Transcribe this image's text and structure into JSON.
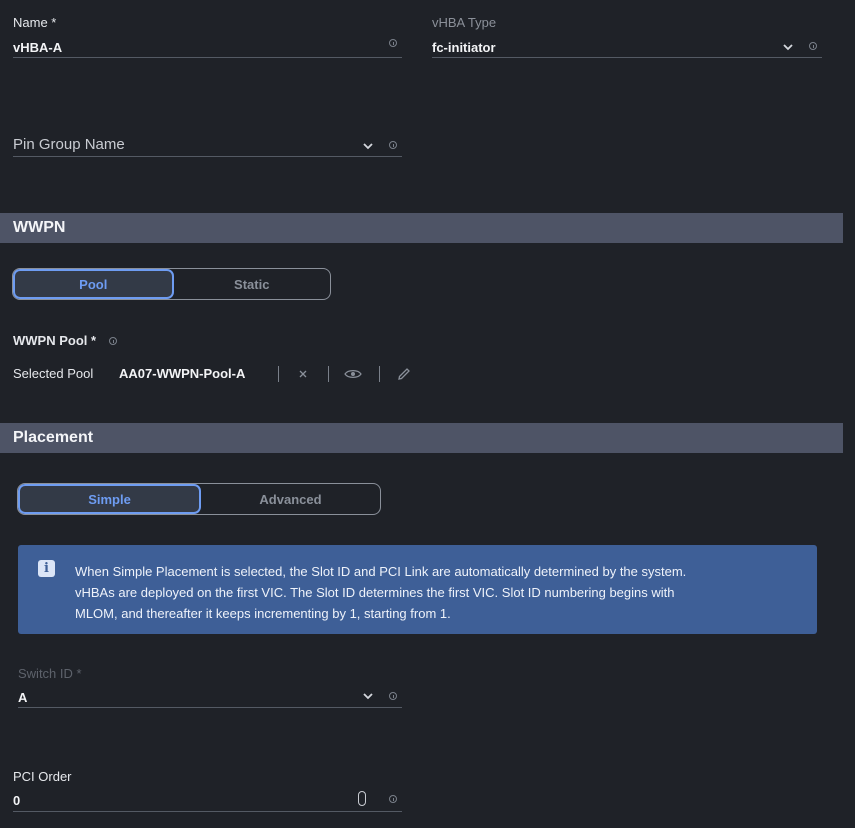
{
  "general": {
    "name_label": "Name *",
    "name_value": "vHBA-A",
    "vhba_type_label": "vHBA Type",
    "vhba_type_value": "fc-initiator",
    "pin_group_placeholder": "Pin Group Name"
  },
  "wwpn": {
    "section_title": "WWPN",
    "toggle": {
      "options": [
        "Pool",
        "Static"
      ],
      "selected": "Pool"
    },
    "pool_label": "WWPN Pool *",
    "selected_pool_label": "Selected Pool",
    "selected_pool_value": "AA07-WWPN-Pool-A",
    "actions": [
      "clear-icon",
      "eye-icon",
      "pencil-icon"
    ]
  },
  "placement": {
    "section_title": "Placement",
    "toggle": {
      "options": [
        "Simple",
        "Advanced"
      ],
      "selected": "Simple"
    },
    "notice_lines": [
      "When Simple Placement is selected, the Slot ID and PCI Link are automatically determined by the system.",
      "vHBAs are deployed on the first VIC. The Slot ID determines the first VIC. Slot ID numbering begins with",
      "MLOM, and thereafter it keeps incrementing by 1, starting from 1."
    ],
    "notice_icon": "info-icon",
    "switch_id_label": "Switch ID *",
    "switch_id_value": "A",
    "pci_order_label": "PCI Order",
    "pci_order_value": "0"
  },
  "colors": {
    "background": "#1f2228",
    "section_bar": "#4e5466",
    "accent": "#6e9cf2",
    "notice_bg": "#3e5f97"
  }
}
